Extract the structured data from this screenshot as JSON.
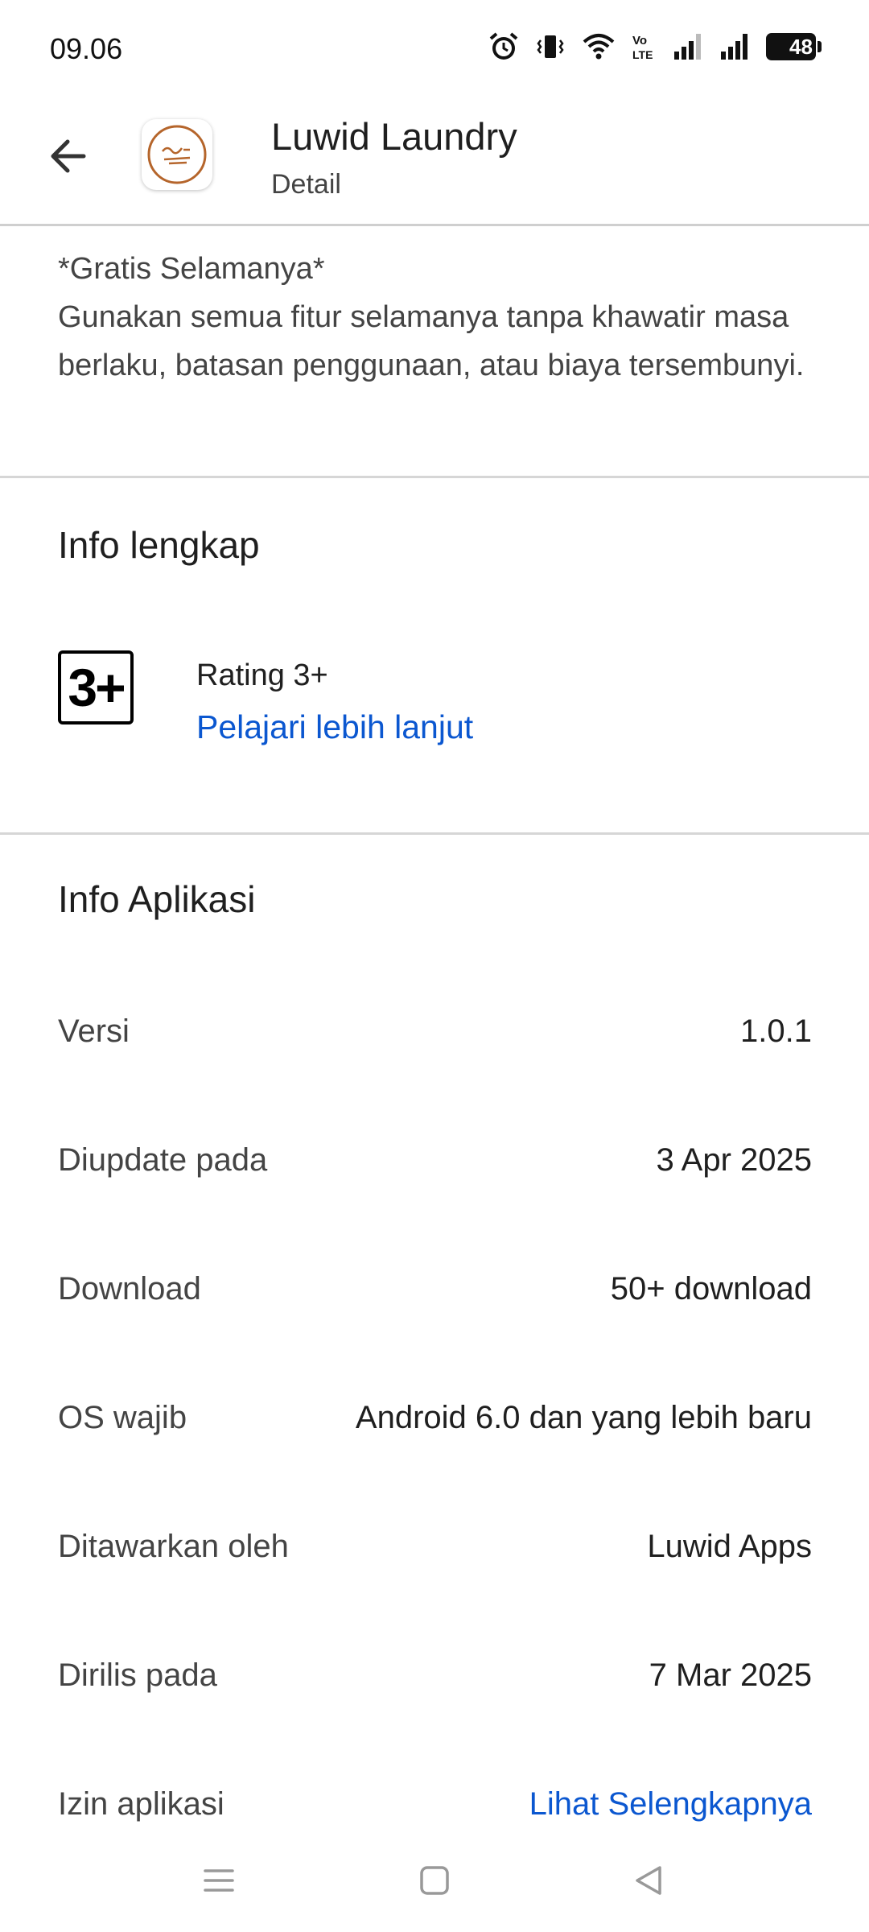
{
  "status_bar": {
    "time": "09.06",
    "battery": "48",
    "icons": [
      "alarm-icon",
      "vibrate-icon",
      "wifi-icon",
      "volte-icon",
      "signal-icon",
      "signal-icon",
      "battery-icon"
    ]
  },
  "header": {
    "app_name": "Luwid Laundry",
    "subtitle": "Detail",
    "back_icon": "arrow-left-icon"
  },
  "description": {
    "line1": "*Gratis Selamanya*",
    "line2": "Gunakan semua fitur selamanya tanpa khawatir masa berlaku, batasan penggunaan, atau biaya tersembunyi."
  },
  "full_info": {
    "title": "Info lengkap",
    "badge": "3+",
    "rating_label": "Rating 3+",
    "learn_more": "Pelajari lebih lanjut"
  },
  "app_info": {
    "title": "Info Aplikasi",
    "rows": [
      {
        "label": "Versi",
        "value": "1.0.1"
      },
      {
        "label": "Diupdate pada",
        "value": "3 Apr 2025"
      },
      {
        "label": "Download",
        "value": "50+ download"
      },
      {
        "label": "OS wajib",
        "value": "Android 6.0 dan yang lebih baru"
      },
      {
        "label": "Ditawarkan oleh",
        "value": "Luwid Apps"
      },
      {
        "label": "Dirilis pada",
        "value": "7 Mar 2025"
      },
      {
        "label": "Izin aplikasi",
        "value": "Lihat Selengkapnya"
      }
    ]
  },
  "colors": {
    "link": "#0b57d0",
    "brand_icon": "#b5652b"
  }
}
